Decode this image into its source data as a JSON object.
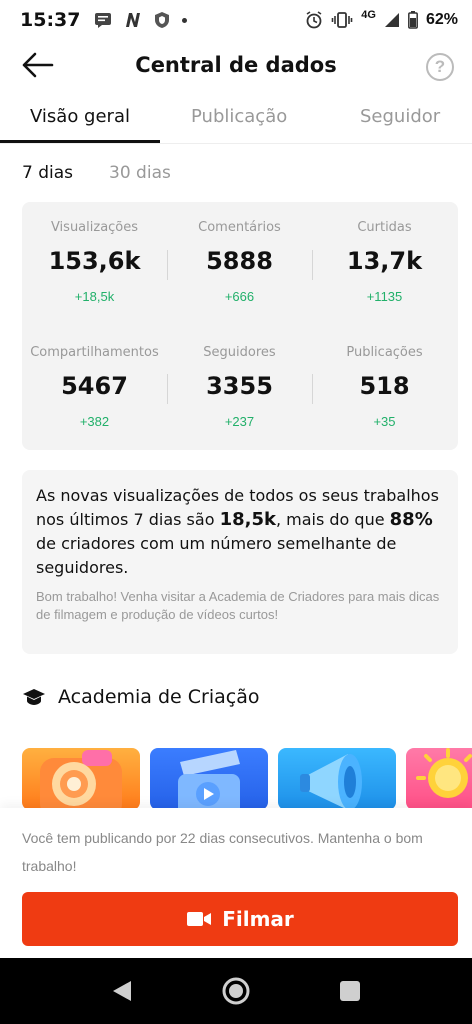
{
  "status_bar": {
    "time": "15:37",
    "network": "4G",
    "battery": "62%"
  },
  "header": {
    "title": "Central de dados",
    "help_label": "?"
  },
  "tabs": [
    {
      "label": "Visão geral",
      "active": true
    },
    {
      "label": "Publicação",
      "active": false
    },
    {
      "label": "Seguidor",
      "active": false
    }
  ],
  "range": {
    "selected": "7 dias",
    "other": "30 dias"
  },
  "stats": [
    {
      "label": "Visualizações",
      "value": "153,6k",
      "delta": "+18,5k"
    },
    {
      "label": "Comentários",
      "value": "5888",
      "delta": "+666"
    },
    {
      "label": "Curtidas",
      "value": "13,7k",
      "delta": "+1135"
    },
    {
      "label": "Compartilhamentos",
      "value": "5467",
      "delta": "+382"
    },
    {
      "label": "Seguidores",
      "value": "3355",
      "delta": "+237"
    },
    {
      "label": "Publicações",
      "value": "518",
      "delta": "+35"
    }
  ],
  "insight": {
    "part1": "As novas visualizações de todos os seus trabalhos nos últimos 7 dias são ",
    "highlight1": "18,5k",
    "part2": ", mais do que ",
    "highlight2": "88%",
    "part3": " de criadores com um número semelhante de seguidores.",
    "sub": "Bom trabalho! Venha visitar a Academia de Criadores para mais dicas de filmagem e produção de vídeos curtos!"
  },
  "academy": {
    "title": "Academia de Criação"
  },
  "footer": {
    "streak": "Você tem publicando por 22 dias consecutivos. Mantenha o bom trabalho!",
    "film_label": "Filmar"
  },
  "colors": {
    "accent": "#ef3b12",
    "positive": "#22b06a"
  }
}
